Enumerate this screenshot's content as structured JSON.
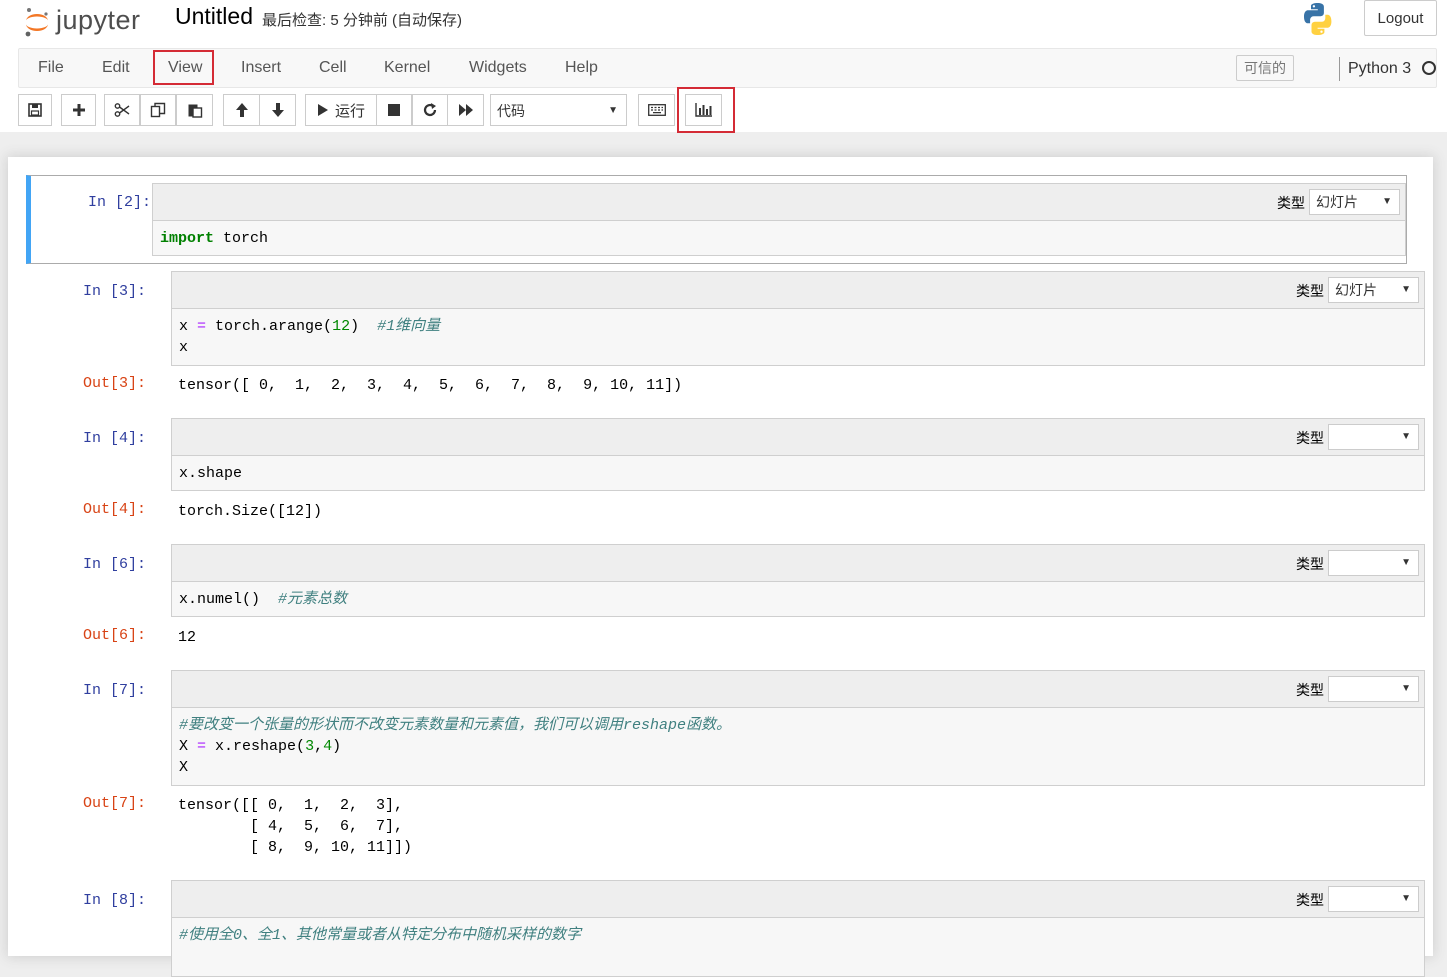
{
  "header": {
    "logo_text": "jupyter",
    "notebook_name": "Untitled",
    "checkpoint": "最后检查: 5 分钟前  (自动保存)",
    "logout_label": "Logout"
  },
  "menu": {
    "items": [
      "File",
      "Edit",
      "View",
      "Insert",
      "Cell",
      "Kernel",
      "Widgets",
      "Help"
    ],
    "trusted": "可信的",
    "kernel_name": "Python 3"
  },
  "toolbar": {
    "run_label": "运行",
    "cell_type": "代码"
  },
  "celltoolbar": {
    "label": "类型"
  },
  "cells": [
    {
      "in_prompt": "In  [2]:",
      "slide_type": "幻灯片",
      "code": [
        "import torch"
      ]
    },
    {
      "in_prompt": "In  [3]:",
      "slide_type": "幻灯片",
      "code": [
        "x = torch.arange(12)  #1维向量",
        "x"
      ],
      "out_prompt": "Out[3]:",
      "output": "tensor([ 0,  1,  2,  3,  4,  5,  6,  7,  8,  9, 10, 11])"
    },
    {
      "in_prompt": "In  [4]:",
      "slide_type": "",
      "code": [
        "x.shape"
      ],
      "out_prompt": "Out[4]:",
      "output": "torch.Size([12])"
    },
    {
      "in_prompt": "In  [6]:",
      "slide_type": "",
      "code": [
        "x.numel()  #元素总数"
      ],
      "out_prompt": "Out[6]:",
      "output": "12"
    },
    {
      "in_prompt": "In  [7]:",
      "slide_type": "",
      "code": [
        "#要改变一个张量的形状而不改变元素数量和元素值，我们可以调用reshape函数。",
        "X = x.reshape(3,4)",
        "X"
      ],
      "out_prompt": "Out[7]:",
      "output": "tensor([[ 0,  1,  2,  3],\n        [ 4,  5,  6,  7],\n        [ 8,  9, 10, 11]])"
    },
    {
      "in_prompt": "In  [8]:",
      "slide_type": "",
      "code": [
        "#使用全0、全1、其他常量或者从特定分布中随机采样的数字"
      ]
    }
  ]
}
